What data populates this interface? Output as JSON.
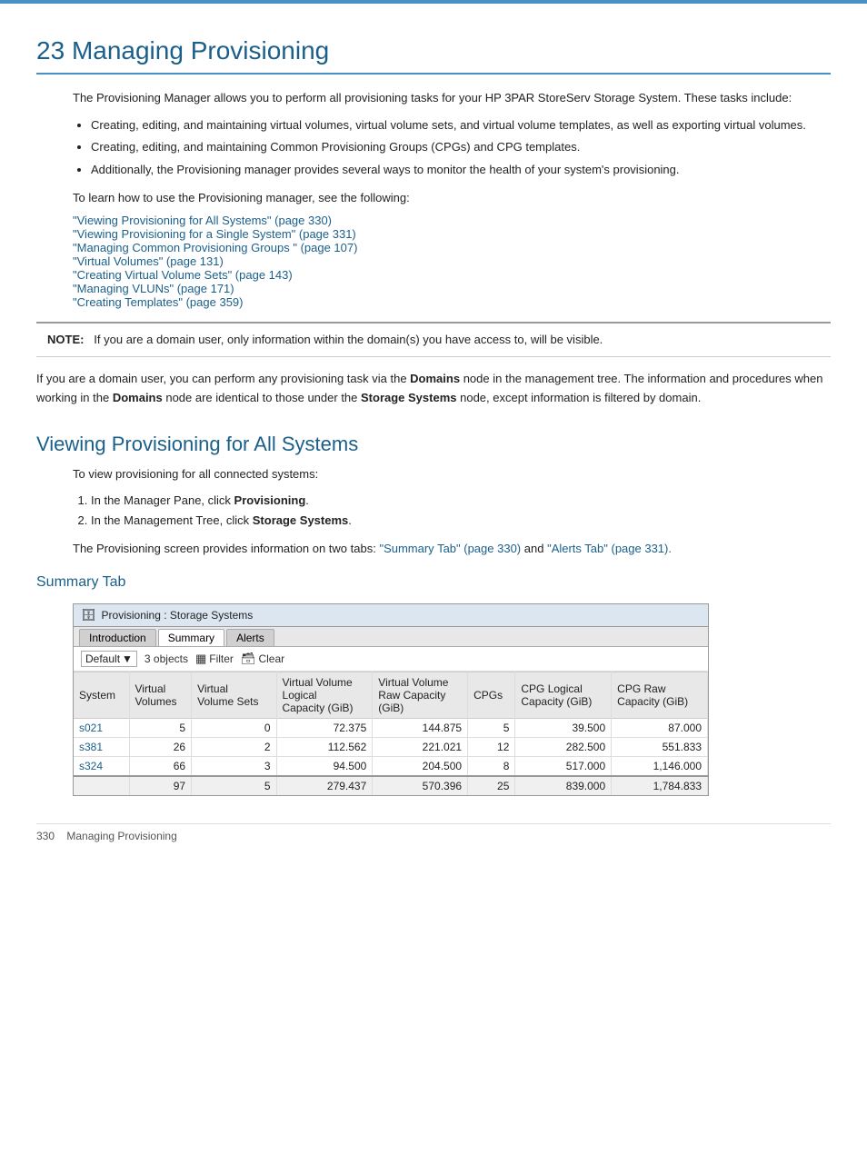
{
  "chapter": {
    "number": "23",
    "title": "Managing Provisioning"
  },
  "intro": {
    "paragraph": "The Provisioning Manager allows you to perform all provisioning tasks for your HP 3PAR StoreServ Storage System. These tasks include:",
    "bullets": [
      "Creating, editing, and maintaining virtual volumes, virtual volume sets, and virtual volume templates, as well as exporting virtual volumes.",
      "Creating, editing, and maintaining Common Provisioning Groups (CPGs) and CPG templates.",
      "Additionally, the Provisioning manager provides several ways to monitor the health of your system's provisioning."
    ],
    "learn_text": "To learn how to use the Provisioning manager, see the following:"
  },
  "links": [
    {
      "text": "\"Viewing Provisioning for All Systems\" (page 330)"
    },
    {
      "text": "\"Viewing Provisioning for a Single System\" (page 331)"
    },
    {
      "text": "\"Managing Common Provisioning Groups \" (page 107)"
    },
    {
      "text": "\"Virtual Volumes\" (page 131)"
    },
    {
      "text": "\"Creating Virtual Volume Sets\" (page 143)"
    },
    {
      "text": "\"Managing VLUNs\" (page 171)"
    },
    {
      "text": "\"Creating Templates\" (page 359)"
    }
  ],
  "note": {
    "label": "NOTE:",
    "text": "If you are a domain user, only information within the domain(s) you have access to, will be visible."
  },
  "domain_text": "If you are a domain user, you can perform any provisioning task via the Domains node in the management tree. The information and procedures when working in the Domains node are identical to those under the Storage Systems node, except information is filtered by domain.",
  "section1": {
    "title": "Viewing Provisioning for All Systems",
    "steps_intro": "To view provisioning for all connected systems:",
    "steps": [
      {
        "num": "1.",
        "text": "In the Manager Pane, click Provisioning."
      },
      {
        "num": "2.",
        "text": "In the Management Tree, click Storage Systems."
      }
    ],
    "screen_text_before": "The Provisioning screen provides information on two tabs: ",
    "screen_link1": "\"Summary Tab\" (page 330)",
    "screen_text_middle": " and ",
    "screen_link2": "\"Alerts Tab\" (page 331).",
    "subsection": {
      "title": "Summary Tab",
      "screenshot": {
        "titlebar": "Provisioning : Storage Systems",
        "tabs": [
          "Introduction",
          "Summary",
          "Alerts"
        ],
        "active_tab": "Summary",
        "toolbar": {
          "dropdown_value": "Default",
          "objects_count": "3 objects",
          "filter_label": "Filter",
          "clear_label": "Clear"
        },
        "table": {
          "columns": [
            "System",
            "Virtual\nVolumes",
            "Virtual\nVolume Sets",
            "Virtual Volume\nLogical\nCapacity (GiB)",
            "Virtual Volume\nRaw Capacity\n(GiB)",
            "CPGs",
            "CPG Logical\nCapacity (GiB)",
            "CPG Raw\nCapacity (GiB)"
          ],
          "rows": [
            {
              "system": "s021",
              "vv": "5",
              "vvs": "0",
              "vv_logical": "72.375",
              "vv_raw": "144.875",
              "cpgs": "5",
              "cpg_logical": "39.500",
              "cpg_raw": "87.000"
            },
            {
              "system": "s381",
              "vv": "26",
              "vvs": "2",
              "vv_logical": "112.562",
              "vv_raw": "221.021",
              "cpgs": "12",
              "cpg_logical": "282.500",
              "cpg_raw": "551.833"
            },
            {
              "system": "s324",
              "vv": "66",
              "vvs": "3",
              "vv_logical": "94.500",
              "vv_raw": "204.500",
              "cpgs": "8",
              "cpg_logical": "517.000",
              "cpg_raw": "1,146.000"
            }
          ],
          "totals": {
            "vv": "97",
            "vvs": "5",
            "vv_logical": "279.437",
            "vv_raw": "570.396",
            "cpgs": "25",
            "cpg_logical": "839.000",
            "cpg_raw": "1,784.833"
          }
        }
      }
    }
  },
  "footer": {
    "page_num": "330",
    "text": "Managing Provisioning"
  }
}
